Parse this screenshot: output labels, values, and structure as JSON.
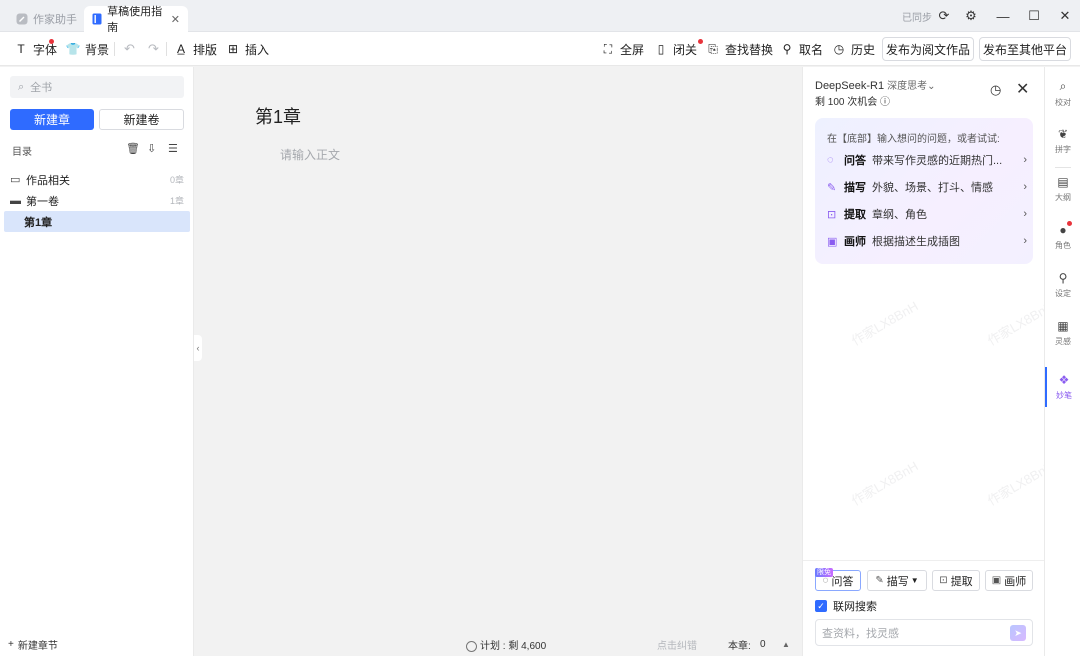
{
  "titlebar": {
    "tabs": [
      {
        "label": "作家助手",
        "icon": "pen-icon",
        "active": false
      },
      {
        "label": "草稿使用指南",
        "icon": "document-icon",
        "active": true
      }
    ],
    "sync_status": "已同步"
  },
  "toolbar": {
    "font": "字体",
    "background": "背景",
    "layout": "排版",
    "insert": "插入",
    "fullscreen": "全屏",
    "focus": "闭关",
    "find_replace": "查找替换",
    "naming": "取名",
    "history": "历史",
    "publish_yuewen": "发布为阅文作品",
    "publish_other": "发布至其他平台"
  },
  "left": {
    "search_placeholder": "全书",
    "new_chapter": "新建章",
    "new_volume": "新建卷",
    "directory": "目录",
    "tree": [
      {
        "label": "作品相关",
        "count": "0章"
      },
      {
        "label": "第一卷",
        "count": "1章"
      },
      {
        "label": "第1章",
        "selected": true
      }
    ],
    "new_section": "新建章节"
  },
  "editor": {
    "chapter_title": "第1章",
    "body_placeholder": "请输入正文",
    "plan": "计划 : 剩 4,600",
    "click_correct": "点击纠错",
    "this_chapter_label": "本章:",
    "this_chapter_count": "0"
  },
  "ai": {
    "model": "DeepSeek-R1",
    "model_mode": "深度思考",
    "remaining_prefix": "剩",
    "remaining_count": "100",
    "remaining_suffix": "次机会",
    "hint": "在【底部】输入想问的问题，或者试试:",
    "suggestions": [
      {
        "name": "问答",
        "desc": "带来写作灵感的近期热门...",
        "icon": "qa-icon"
      },
      {
        "name": "描写",
        "desc": "外貌、场景、打斗、情感",
        "icon": "brush-icon"
      },
      {
        "name": "提取",
        "desc": "章纲、角色",
        "icon": "extract-icon"
      },
      {
        "name": "画师",
        "desc": "根据描述生成插图",
        "icon": "image-icon"
      }
    ],
    "watermark": "作家LX8BnH",
    "modes": {
      "qa": "问答",
      "limited": "限免",
      "describe": "描写",
      "extract": "提取",
      "painter": "画师"
    },
    "web_search": "联网搜索",
    "input_placeholder": "查资料，找灵感"
  },
  "sidebar": {
    "items": [
      {
        "label": "校对",
        "icon": "proofread-icon"
      },
      {
        "label": "拼字",
        "icon": "spell-icon"
      },
      {
        "label": "大纲",
        "icon": "outline-icon"
      },
      {
        "label": "角色",
        "icon": "character-icon"
      },
      {
        "label": "设定",
        "icon": "setting-icon"
      },
      {
        "label": "灵感",
        "icon": "inspiration-icon"
      },
      {
        "label": "妙笔",
        "icon": "magic-pen-icon",
        "active": true
      }
    ]
  },
  "colors": {
    "primary": "#2f6bff",
    "accent": "#8a5cf0",
    "badge": "#e8333b"
  }
}
